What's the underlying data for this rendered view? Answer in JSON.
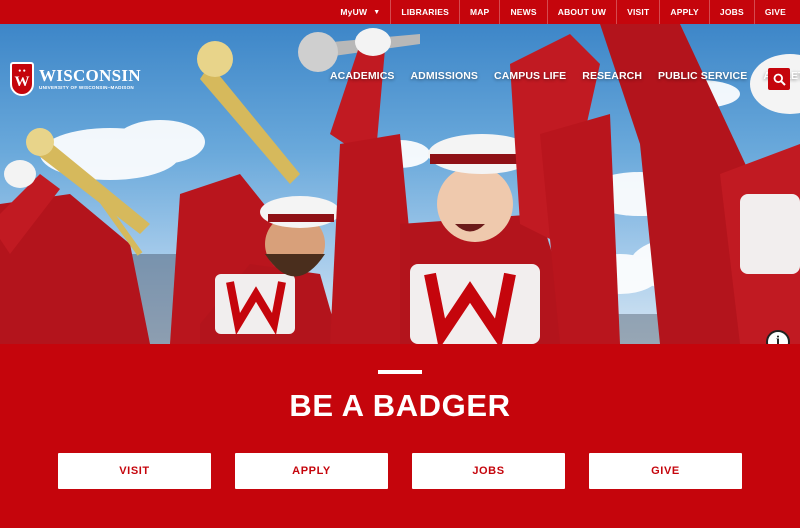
{
  "utility_nav": {
    "items": [
      {
        "label": "MyUW",
        "has_dropdown": true
      },
      {
        "label": "LIBRARIES"
      },
      {
        "label": "MAP"
      },
      {
        "label": "NEWS"
      },
      {
        "label": "ABOUT UW"
      },
      {
        "label": "VISIT"
      },
      {
        "label": "APPLY"
      },
      {
        "label": "JOBS"
      },
      {
        "label": "GIVE"
      }
    ]
  },
  "logo": {
    "name": "WISCONSIN",
    "subtitle": "UNIVERSITY OF WISCONSIN–MADISON",
    "crest_icon": "uw-crest-icon"
  },
  "main_nav": {
    "items": [
      "ACADEMICS",
      "ADMISSIONS",
      "CAMPUS LIFE",
      "RESEARCH",
      "PUBLIC SERVICE",
      "ATHLETICS"
    ]
  },
  "icons": {
    "search": "search-icon",
    "info": "info-icon",
    "dropdown": "chevron-down-icon"
  },
  "cta": {
    "headline": "BE A BADGER",
    "buttons": [
      "VISIT",
      "APPLY",
      "JOBS",
      "GIVE"
    ]
  },
  "colors": {
    "brand_red": "#c5050c",
    "white": "#ffffff"
  }
}
